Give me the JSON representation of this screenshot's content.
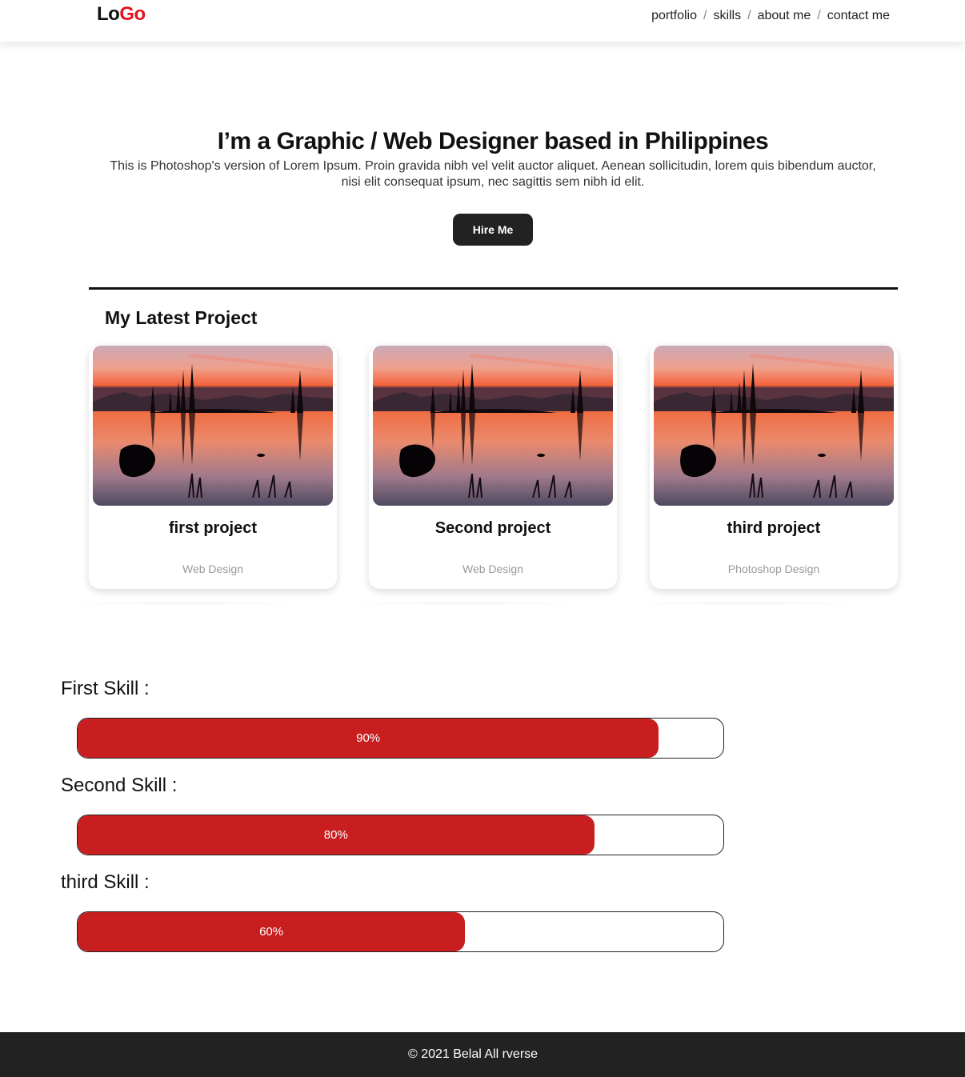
{
  "header": {
    "logo_part1": "Lo",
    "logo_part2": "Go",
    "nav": [
      {
        "label": "portfolio"
      },
      {
        "label": "skills"
      },
      {
        "label": "about me"
      },
      {
        "label": "contact me"
      }
    ],
    "separator": "/"
  },
  "hero": {
    "title": "I’m a Graphic / Web Designer based in Philippines",
    "text": "This is Photoshop's version of Lorem Ipsum. Proin gravida nibh vel velit auctor aliquet. Aenean sollicitudin, lorem quis bibendum auctor, nisi elit consequat ipsum, nec sagittis sem nibh id elit.",
    "button_label": "Hire Me"
  },
  "projects": {
    "section_title": "My Latest Project",
    "items": [
      {
        "title": "first project",
        "category": "Web Design"
      },
      {
        "title": "Second project",
        "category": "Web Design"
      },
      {
        "title": "third project",
        "category": "Photoshop Design"
      }
    ]
  },
  "skills": [
    {
      "label": "First Skill :",
      "percent_label": "90%",
      "percent": 90
    },
    {
      "label": "Second Skill :",
      "percent_label": "80%",
      "percent": 80
    },
    {
      "label": "third Skill :",
      "percent_label": "60%",
      "percent": 60
    }
  ],
  "footer": {
    "text": "© 2021 Belal All rverse"
  },
  "colors": {
    "accent": "#c91e1f",
    "logo_accent": "#e0141e",
    "button_bg": "#222222",
    "footer_bg": "#222222"
  }
}
